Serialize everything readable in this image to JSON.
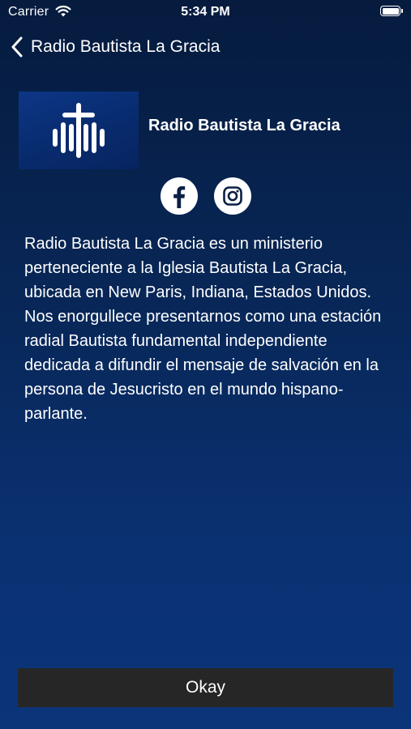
{
  "status_bar": {
    "carrier": "Carrier",
    "time": "5:34 PM",
    "icons": [
      "wifi-icon",
      "battery-icon"
    ]
  },
  "nav": {
    "back_icon": "chevron-left-icon",
    "title": "Radio Bautista La Gracia"
  },
  "station": {
    "logo_icon": "cross-soundwave-logo",
    "name": "Radio Bautista La Gracia"
  },
  "social": [
    {
      "icon": "facebook-icon"
    },
    {
      "icon": "instagram-icon"
    }
  ],
  "description": "Radio Bautista La Gracia es un ministerio perteneciente a la Iglesia Bautista La Gracia, ubicada en New Paris, Indiana, Estados Unidos. Nos enorgullece presentarnos como una estación radial Bautista fundamental independiente dedicada a difundir el mensaje de salvación en la persona de Jesucristo en el mundo hispano-parlante.",
  "actions": {
    "okay_label": "Okay"
  },
  "colors": {
    "background_top": "#061b3e",
    "background_bottom": "#0b3579",
    "button_bg": "#262626",
    "text": "#ffffff"
  }
}
